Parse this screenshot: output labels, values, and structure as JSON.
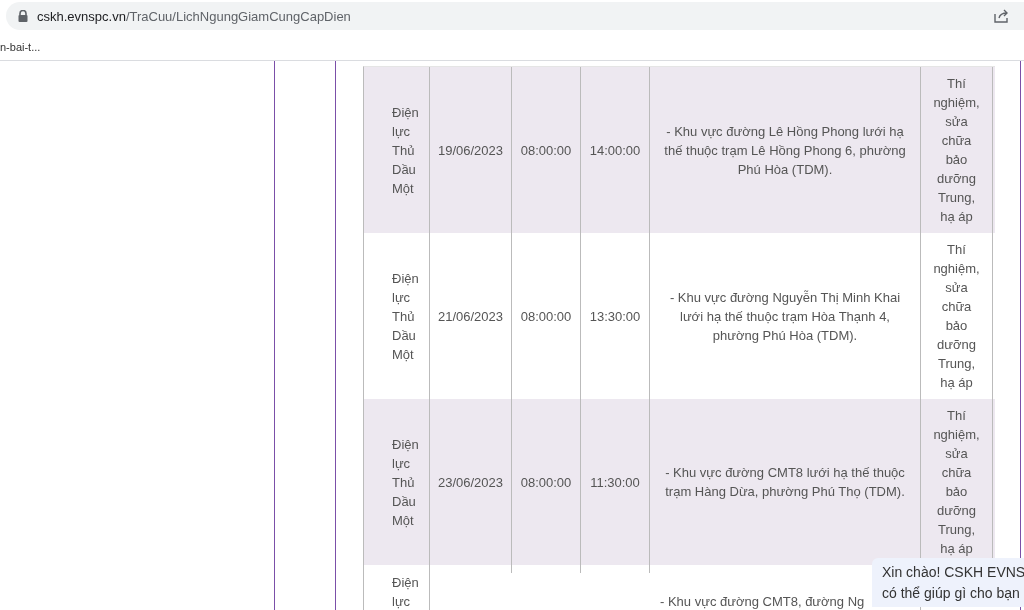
{
  "browser": {
    "url_domain": "cskh.evnspc.vn",
    "url_path": "/TraCuu/LichNgungGiamCungCapDien",
    "bookmark": "n-bai-t..."
  },
  "table": {
    "rows": [
      {
        "unit": "Điện lực Thủ Dầu Một",
        "date": "19/06/2023",
        "start": "08:00:00",
        "end": "14:00:00",
        "area": "- Khu vực đường Lê Hồng Phong lưới hạ thế thuộc trạm Lê Hồng Phong 6, phường Phú Hòa (TDM).",
        "reason": "Thí nghiệm, sửa chữa bảo dưỡng Trung, hạ áp",
        "shaded": true
      },
      {
        "unit": "Điện lực Thủ Dầu Một",
        "date": "21/06/2023",
        "start": "08:00:00",
        "end": "13:30:00",
        "area": "- Khu vực đường Nguyễn Thị Minh Khai lưới hạ thế thuộc trạm Hòa Thạnh 4, phường Phú Hòa (TDM).",
        "reason": "Thí nghiệm, sửa chữa bảo dưỡng Trung, hạ áp",
        "shaded": false
      },
      {
        "unit": "Điện lực Thủ Dầu Một",
        "date": "23/06/2023",
        "start": "08:00:00",
        "end": "11:30:00",
        "area": "- Khu vực đường CMT8 lưới hạ thế thuộc trạm Hàng Dừa, phường Phú Thọ (TDM).",
        "reason": "Thí nghiệm, sửa chữa bảo dưỡng Trung, hạ áp",
        "shaded": true
      },
      {
        "unit": "Điện lực",
        "area": "- Khu vực đường CMT8, đường Ng",
        "shaded": false
      }
    ]
  },
  "chat": {
    "lines": [
      "Xin chào! CSKH EVNS",
      "có thể giúp gì cho bạn"
    ]
  }
}
